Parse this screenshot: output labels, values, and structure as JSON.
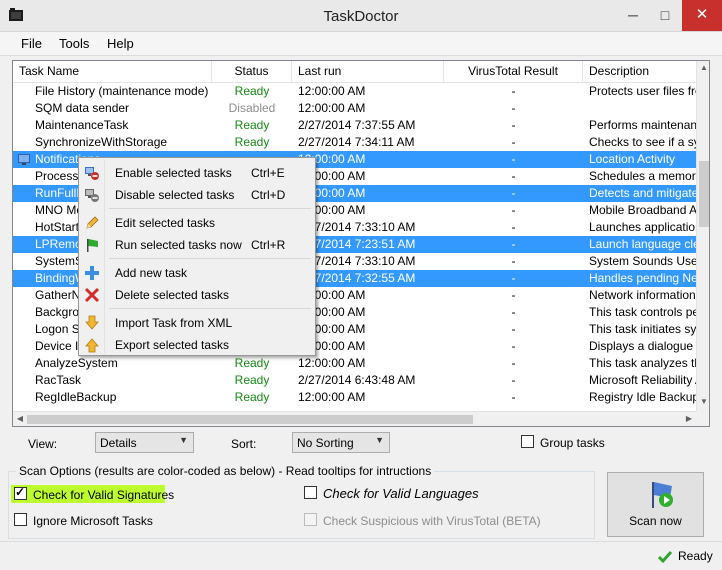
{
  "window": {
    "title": "TaskDoctor",
    "min_glyph": "─",
    "max_glyph": "□",
    "close_glyph": "✕"
  },
  "menu": [
    "File",
    "Tools",
    "Help"
  ],
  "columns": [
    "Task Name",
    "Status",
    "Last run",
    "VirusTotal Result",
    "Description"
  ],
  "rows": [
    {
      "name": "File History (maintenance mode)",
      "status": "Ready",
      "status_style": "green",
      "last_run": "12:00:00 AM",
      "vt": "-",
      "desc": "Protects user files from",
      "selected": false,
      "icon": false
    },
    {
      "name": "SQM data sender",
      "status": "Disabled",
      "status_style": "gray",
      "last_run": "12:00:00 AM",
      "vt": "-",
      "desc": "",
      "selected": false,
      "icon": false
    },
    {
      "name": "MaintenanceTask",
      "status": "Ready",
      "status_style": "green",
      "last_run": "2/27/2014 7:37:55 AM",
      "vt": "-",
      "desc": "Performs maintenance",
      "selected": false,
      "icon": false
    },
    {
      "name": "SynchronizeWithStorage",
      "status": "Ready",
      "status_style": "green",
      "last_run": "2/27/2014 7:34:11 AM",
      "vt": "-",
      "desc": "Checks to see if a sync",
      "selected": false,
      "icon": false
    },
    {
      "name": "Notifications",
      "status": "",
      "status_style": "",
      "last_run": "12:00:00 AM",
      "vt": "-",
      "desc": "Location Activity",
      "selected": true,
      "icon": true
    },
    {
      "name": "ProcessM",
      "status": "",
      "status_style": "",
      "last_run": "12:00:00 AM",
      "vt": "-",
      "desc": "Schedules a memory c",
      "selected": false,
      "icon": false
    },
    {
      "name": "RunFullM",
      "status": "",
      "status_style": "",
      "last_run": "12:00:00 AM",
      "vt": "-",
      "desc": "Detects and mitigates",
      "selected": true,
      "icon": false
    },
    {
      "name": "MNO Met",
      "status": "",
      "status_style": "",
      "last_run": "12:00:00 AM",
      "vt": "-",
      "desc": "Mobile Broadband Acc",
      "selected": false,
      "icon": false
    },
    {
      "name": "HotStart",
      "status": "",
      "status_style": "",
      "last_run": "2/27/2014 7:33:10 AM",
      "vt": "-",
      "desc": "Launches applications",
      "selected": false,
      "icon": false
    },
    {
      "name": "LPRemov",
      "status": "",
      "status_style": "",
      "last_run": "2/27/2014 7:23:51 AM",
      "vt": "-",
      "desc": "Launch language clea",
      "selected": true,
      "icon": false
    },
    {
      "name": "SystemSo",
      "status": "",
      "status_style": "",
      "last_run": "2/27/2014 7:33:10 AM",
      "vt": "-",
      "desc": "System Sounds User M",
      "selected": false,
      "icon": false
    },
    {
      "name": "BindingW",
      "status": "",
      "status_style": "",
      "last_run": "2/27/2014 7:32:55 AM",
      "vt": "-",
      "desc": "Handles pending Netw",
      "selected": true,
      "icon": false
    },
    {
      "name": "GatherNe",
      "status": "",
      "status_style": "",
      "last_run": "12:00:00 AM",
      "vt": "-",
      "desc": "Network information co",
      "selected": false,
      "icon": false
    },
    {
      "name": "Backgrou",
      "status": "",
      "status_style": "",
      "last_run": "12:00:00 AM",
      "vt": "-",
      "desc": "This task controls peri",
      "selected": false,
      "icon": false
    },
    {
      "name": "Logon Sy",
      "status": "",
      "status_style": "",
      "last_run": "12:00:00 AM",
      "vt": "-",
      "desc": "This task initiates sync",
      "selected": false,
      "icon": false
    },
    {
      "name": "Device In",
      "status": "",
      "status_style": "",
      "last_run": "12:00:00 AM",
      "vt": "-",
      "desc": "Displays a dialogue bo",
      "selected": false,
      "icon": false
    },
    {
      "name": "AnalyzeSystem",
      "status": "Ready",
      "status_style": "green",
      "last_run": "12:00:00 AM",
      "vt": "-",
      "desc": "This task analyzes the",
      "selected": false,
      "icon": false
    },
    {
      "name": "RacTask",
      "status": "Ready",
      "status_style": "green",
      "last_run": "2/27/2014 6:43:48 AM",
      "vt": "-",
      "desc": "Microsoft Reliability An",
      "selected": false,
      "icon": false
    },
    {
      "name": "RegIdleBackup",
      "status": "Ready",
      "status_style": "green",
      "last_run": "12:00:00 AM",
      "vt": "-",
      "desc": "Registry Idle Backup T",
      "selected": false,
      "icon": false
    }
  ],
  "context_menu": [
    {
      "label": "Enable selected tasks",
      "shortcut": "Ctrl+E",
      "icon": "enable-tasks-icon"
    },
    {
      "label": "Disable selected tasks",
      "shortcut": "Ctrl+D",
      "icon": "disable-tasks-icon"
    },
    {
      "label": "Edit selected tasks",
      "shortcut": "",
      "icon": "edit-pencil-icon"
    },
    {
      "label": "Run selected tasks now",
      "shortcut": "Ctrl+R",
      "icon": "run-flag-icon"
    },
    {
      "label": "Add new task",
      "shortcut": "",
      "icon": "add-plus-icon"
    },
    {
      "label": "Delete selected tasks",
      "shortcut": "",
      "icon": "delete-x-icon"
    },
    {
      "label": "Import Task from XML",
      "shortcut": "",
      "icon": "import-arrow-icon"
    },
    {
      "label": "Export selected tasks",
      "shortcut": "",
      "icon": "export-arrow-icon"
    }
  ],
  "controls": {
    "view_label": "View:",
    "view_value": "Details",
    "sort_label": "Sort:",
    "sort_value": "No Sorting",
    "group_tasks": "Group tasks"
  },
  "scan_options": {
    "group_label": "Scan Options (results are color-coded as below) - Read tooltips for intructions",
    "check_signatures": "Check for Valid Signatures",
    "check_signatures_checked": true,
    "ignore_ms": "Ignore Microsoft Tasks",
    "check_languages": "Check for Valid Languages",
    "check_virustotal": "Check Suspicious with VirusTotal (BETA)",
    "scan_button": "Scan now"
  },
  "status_bar": {
    "text": "Ready"
  },
  "colors": {
    "selection": "#3399ff",
    "ready": "#138a13",
    "highlight": "#bdfc2e",
    "close": "#c7302c"
  }
}
